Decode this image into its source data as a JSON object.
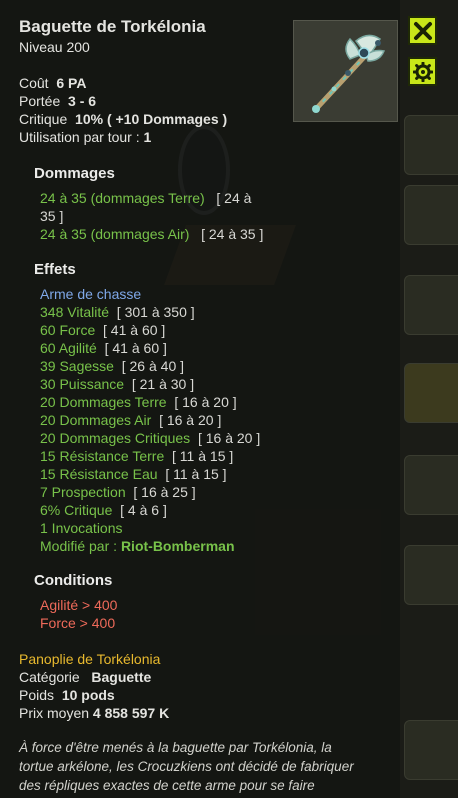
{
  "item": {
    "name": "Baguette de Torkélonia",
    "level": "Niveau  200",
    "cost_label": "Coût",
    "cost_value": "6 PA",
    "range_label": "Portée",
    "range_value": "3 - 6",
    "crit_label": "Critique",
    "crit_value": "10% ( +10 Dommages )",
    "uses_label": "Utilisation par tour :",
    "uses_value": "1"
  },
  "damage": {
    "heading": "Dommages",
    "lines": [
      {
        "text": "24 à 35 (dommages Terre)",
        "range_a": "[ 24 à",
        "range_b": "35 ]"
      },
      {
        "text": "24 à 35 (dommages Air)",
        "range": "[ 24 à 35 ]"
      }
    ]
  },
  "effects": {
    "heading": "Effets",
    "type_line": "Arme de chasse",
    "lines": [
      {
        "text": "348 Vitalité",
        "range": "[ 301 à 350 ]"
      },
      {
        "text": "60 Force",
        "range": "[ 41 à 60 ]"
      },
      {
        "text": "60 Agilité",
        "range": "[ 41 à 60 ]"
      },
      {
        "text": "39 Sagesse",
        "range": "[ 26 à 40 ]"
      },
      {
        "text": "30 Puissance",
        "range": "[ 21 à 30 ]"
      },
      {
        "text": "20 Dommages Terre",
        "range": "[ 16 à 20 ]"
      },
      {
        "text": "20 Dommages Air",
        "range": "[ 16 à 20 ]"
      },
      {
        "text": "20 Dommages Critiques",
        "range": "[ 16 à 20 ]"
      },
      {
        "text": "15 Résistance Terre",
        "range": "[ 11 à 15 ]"
      },
      {
        "text": "15 Résistance Eau",
        "range": "[ 11 à 15 ]"
      },
      {
        "text": "7 Prospection",
        "range": "[ 16 à 25 ]"
      },
      {
        "text": "6% Critique",
        "range": "[ 4 à 6 ]"
      },
      {
        "text": "1 Invocations",
        "range": ""
      }
    ],
    "modified_label": "Modifié par :",
    "modified_by": "Riot-Bomberman"
  },
  "conditions": {
    "heading": "Conditions",
    "lines": [
      "Agilité > 400",
      "Force > 400"
    ]
  },
  "details": {
    "set": "Panoplie de Torkélonia",
    "category_label": "Catégorie",
    "category_value": "Baguette",
    "weight_label": "Poids",
    "weight_value": "10 pods",
    "price_label": "Prix moyen",
    "price_value": "4 858 597 K"
  },
  "description": [
    "À force d'être menés à la baguette par Torkélonia, la",
    "tortue arkélone, les Crocuzkiens ont décidé de fabriquer",
    "des répliques exactes de cette arme pour se faire"
  ],
  "buttons": {
    "close_icon": "close-icon",
    "settings_icon": "gear-icon"
  },
  "colors": {
    "accent_button": "#c8e619",
    "effect_green": "#78c24a",
    "condition_red": "#ee6a5a",
    "set_gold": "#e8b92e",
    "type_blue": "#7fa8e8"
  }
}
